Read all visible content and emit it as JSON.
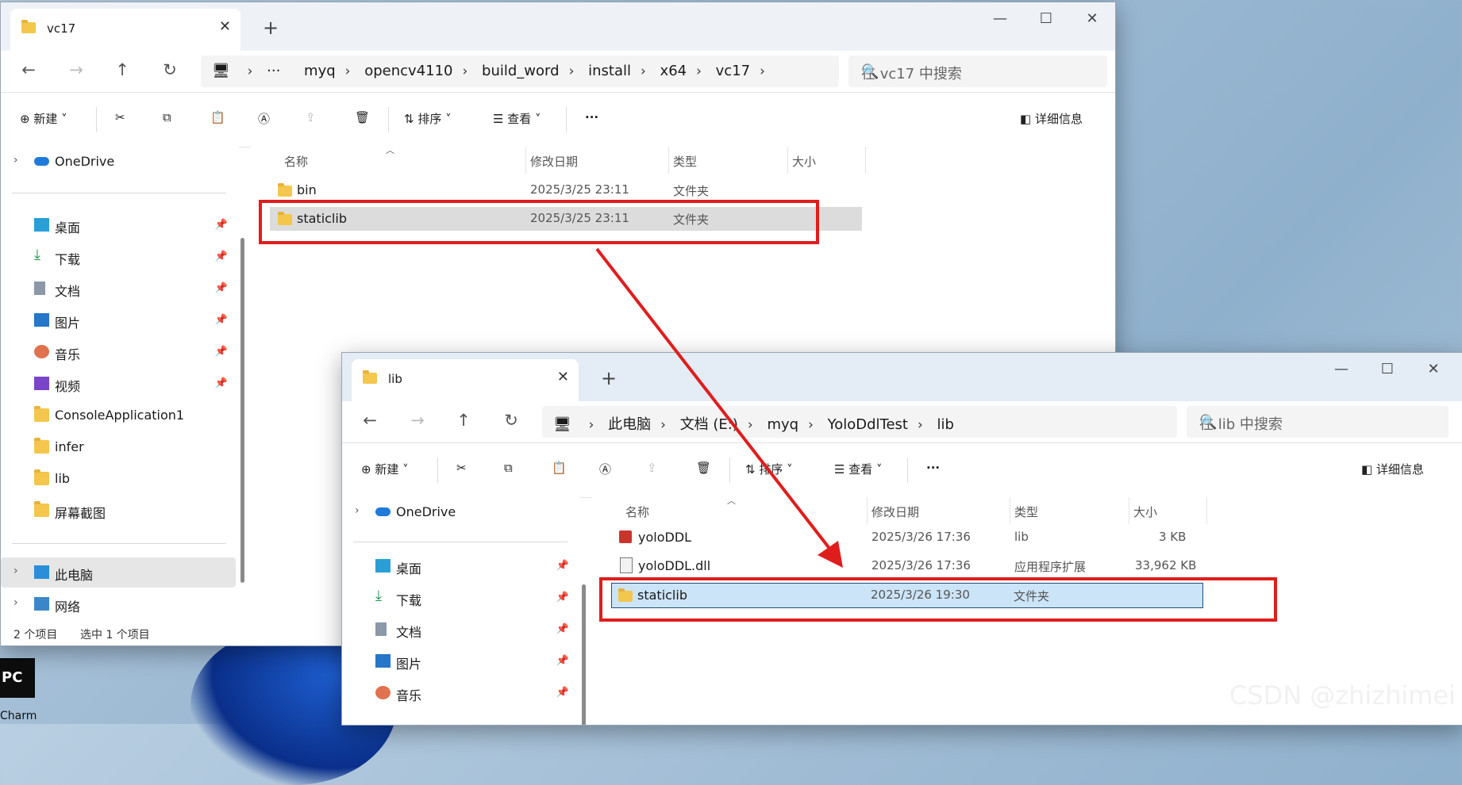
{
  "window1": {
    "tab_title": "vc17",
    "breadcrumb": [
      "myq",
      "opencv4110",
      "build_word",
      "install",
      "x64",
      "vc17"
    ],
    "search_placeholder": "在 vc17 中搜索",
    "toolbar": {
      "new": "新建",
      "sort": "排序",
      "view": "查看",
      "more": "···",
      "details": "详细信息"
    },
    "sidebar": {
      "onedrive": "OneDrive",
      "pinned": [
        "桌面",
        "下载",
        "文档",
        "图片",
        "音乐",
        "视频"
      ],
      "folders": [
        "ConsoleApplication1",
        "infer",
        "lib",
        "屏幕截图"
      ],
      "this_pc": "此电脑",
      "network": "网络"
    },
    "columns": {
      "name": "名称",
      "modified": "修改日期",
      "type": "类型",
      "size": "大小"
    },
    "files": [
      {
        "name": "bin",
        "modified": "2025/3/25 23:11",
        "type": "文件夹",
        "size": ""
      },
      {
        "name": "staticlib",
        "modified": "2025/3/25 23:11",
        "type": "文件夹",
        "size": ""
      }
    ],
    "status": {
      "count": "2 个项目",
      "selected": "选中 1 个项目"
    }
  },
  "window2": {
    "tab_title": "lib",
    "breadcrumb": [
      "此电脑",
      "文档 (E:)",
      "myq",
      "YoloDdlTest",
      "lib"
    ],
    "search_placeholder": "在 lib 中搜索",
    "toolbar": {
      "new": "新建",
      "sort": "排序",
      "view": "查看",
      "more": "···",
      "details": "详细信息"
    },
    "sidebar": {
      "onedrive": "OneDrive",
      "pinned": [
        "桌面",
        "下载",
        "文档",
        "图片",
        "音乐"
      ]
    },
    "columns": {
      "name": "名称",
      "modified": "修改日期",
      "type": "类型",
      "size": "大小"
    },
    "files": [
      {
        "name": "yoloDDL",
        "modified": "2025/3/26 17:36",
        "type": "lib",
        "size": "3 KB"
      },
      {
        "name": "yoloDDL.dll",
        "modified": "2025/3/26 17:36",
        "type": "应用程序扩展",
        "size": "33,962 KB"
      },
      {
        "name": "staticlib",
        "modified": "2025/3/26 19:30",
        "type": "文件夹",
        "size": ""
      }
    ]
  },
  "desktop": {
    "app_icon_text": "PC",
    "app_label": "Charm",
    "watermark": "CSDN @zhizhimei"
  },
  "colors": {
    "annotation_red": "#e01d1d",
    "selection_blue": "#cce4f7"
  }
}
